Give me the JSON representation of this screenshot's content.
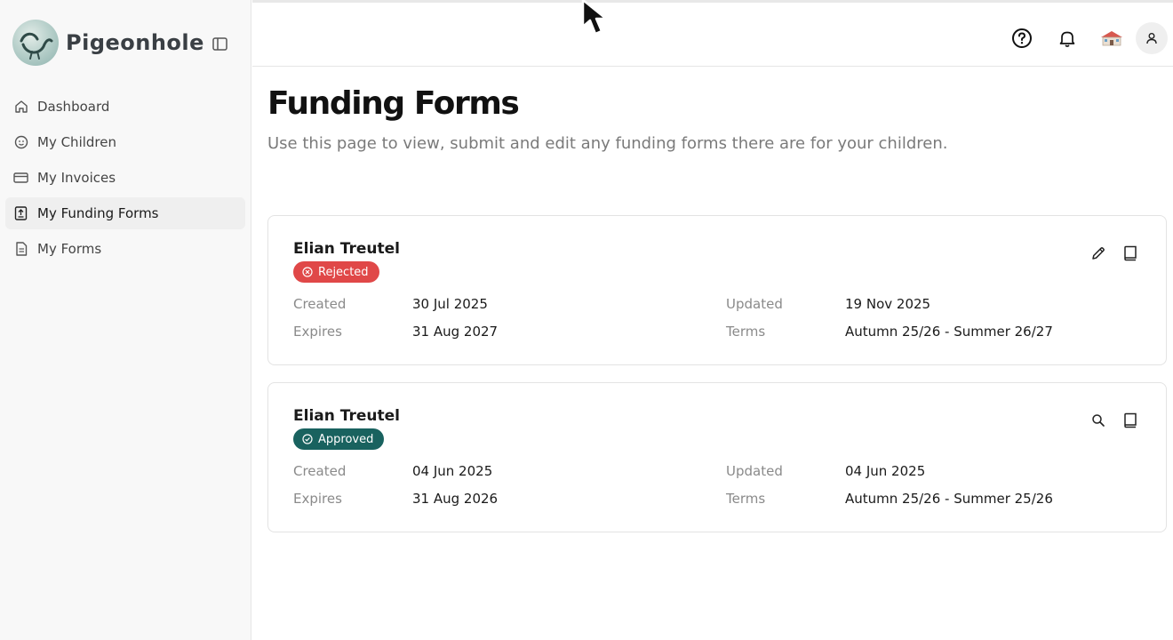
{
  "brand": {
    "name": "Pigeonhole"
  },
  "sidebar": {
    "items": [
      {
        "label": "Dashboard",
        "icon": "home-icon"
      },
      {
        "label": "My Children",
        "icon": "child-icon"
      },
      {
        "label": "My Invoices",
        "icon": "card-icon"
      },
      {
        "label": "My Funding Forms",
        "icon": "funding-icon",
        "active": true
      },
      {
        "label": "My Forms",
        "icon": "document-icon"
      }
    ]
  },
  "header": {
    "icons": [
      "help-icon",
      "bell-icon",
      "school-icon",
      "user-icon"
    ]
  },
  "page": {
    "title": "Funding Forms",
    "subtitle": "Use this page to view, submit and edit any funding forms there are for your children."
  },
  "forms": [
    {
      "name": "Elian Treutel",
      "status": "Rejected",
      "status_color": "#e04848",
      "created_label": "Created",
      "created": "30 Jul 2025",
      "expires_label": "Expires",
      "expires": "31 Aug 2027",
      "updated_label": "Updated",
      "updated": "19 Nov 2025",
      "terms_label": "Terms",
      "terms": "Autumn 25/26 - Summer 26/27",
      "actions": [
        "edit-icon",
        "book-icon"
      ]
    },
    {
      "name": "Elian Treutel",
      "status": "Approved",
      "status_color": "#19625f",
      "created_label": "Created",
      "created": "04 Jun 2025",
      "expires_label": "Expires",
      "expires": "31 Aug 2026",
      "updated_label": "Updated",
      "updated": "04 Jun 2025",
      "terms_label": "Terms",
      "terms": "Autumn 25/26 - Summer 25/26",
      "actions": [
        "search-icon",
        "book-icon"
      ]
    }
  ]
}
